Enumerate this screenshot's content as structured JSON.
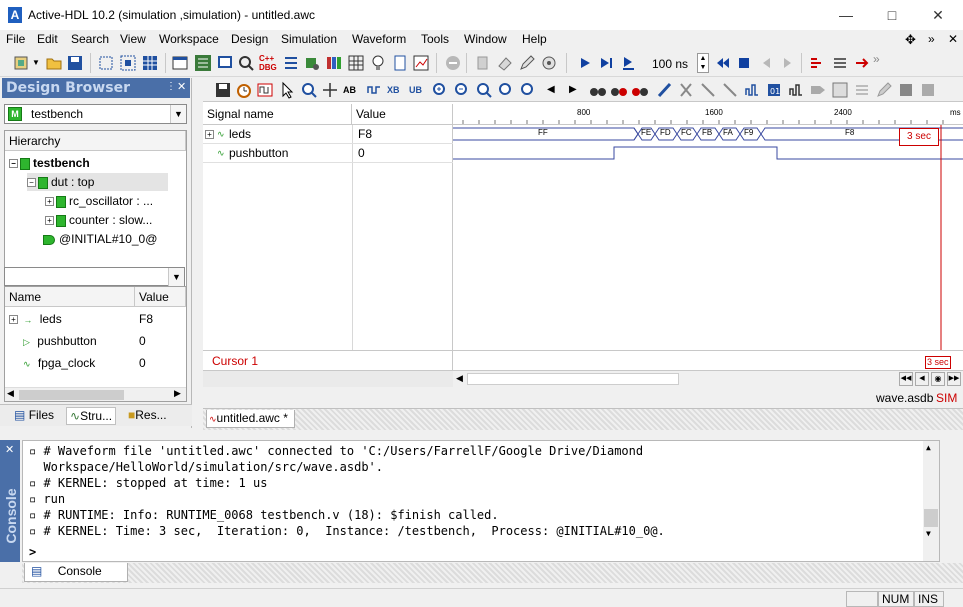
{
  "window": {
    "title": "Active-HDL 10.2 (simulation ,simulation) - untitled.awc",
    "logo_letter": "A"
  },
  "menu": [
    "File",
    "Edit",
    "Search",
    "View",
    "Workspace",
    "Design",
    "Simulation",
    "Waveform",
    "Tools",
    "Window",
    "Help"
  ],
  "toolbar": {
    "sim_time": "100 ns"
  },
  "design_browser": {
    "title": "Design Browser",
    "top_selector": "testbench",
    "hierarchy_header": "Hierarchy",
    "tree": [
      {
        "label": "testbench",
        "level": 0,
        "expander": "-"
      },
      {
        "label": "dut : top",
        "level": 1,
        "expander": "-"
      },
      {
        "label": "rc_oscillator : ...",
        "level": 2,
        "expander": "+"
      },
      {
        "label": "counter : slow...",
        "level": 2,
        "expander": "+"
      },
      {
        "label": "@INITIAL#10_0@",
        "level": 1,
        "expander": ""
      }
    ],
    "signal_header_name": "Name",
    "signal_header_value": "Value",
    "signals": [
      {
        "name": "leds",
        "value": "F8"
      },
      {
        "name": "pushbutton",
        "value": "0"
      },
      {
        "name": "fpga_clock",
        "value": "0"
      }
    ],
    "tabs": [
      "Files",
      "Stru...",
      "Res..."
    ]
  },
  "waveform": {
    "col_signal_name": "Signal name",
    "col_value": "Value",
    "time_unit": "ms",
    "ruler_ticks": [
      "800",
      "1600",
      "2400"
    ],
    "signals": [
      {
        "name": "leds",
        "value": "F8"
      },
      {
        "name": "pushbutton",
        "value": "0"
      }
    ],
    "bus_segments": [
      "FF",
      "FE",
      "FD",
      "FC",
      "FB",
      "FA",
      "F9",
      "F8"
    ],
    "cursor_label": "Cursor 1",
    "cursor_time_top": "3 sec",
    "cursor_time_bottom": "3 sec",
    "tab_label": "untitled.awc *",
    "db_label": "wave.asdb",
    "sim_label": "SIM"
  },
  "console": {
    "side_label": "Console",
    "lines": [
      "▫ # Waveform file 'untitled.awc' connected to 'C:/Users/FarrellF/Google Drive/Diamond",
      "  Workspace/HelloWorld/simulation/src/wave.asdb'.",
      "▫ # KERNEL: stopped at time: 1 us",
      "▫ run",
      "▫ # RUNTIME: Info: RUNTIME_0068 testbench.v (18): $finish called.",
      "▫ # KERNEL: Time: 3 sec,  Iteration: 0,  Instance: /testbench,  Process: @INITIAL#10_0@."
    ],
    "prompt": ">",
    "tab_label": "Console"
  },
  "status": {
    "num": "NUM",
    "ins": "INS"
  },
  "colors": {
    "accent": "#4a6fa8",
    "cursor": "#cc0000",
    "bus": "#3a4aa0",
    "chip": "#2eb52e"
  }
}
